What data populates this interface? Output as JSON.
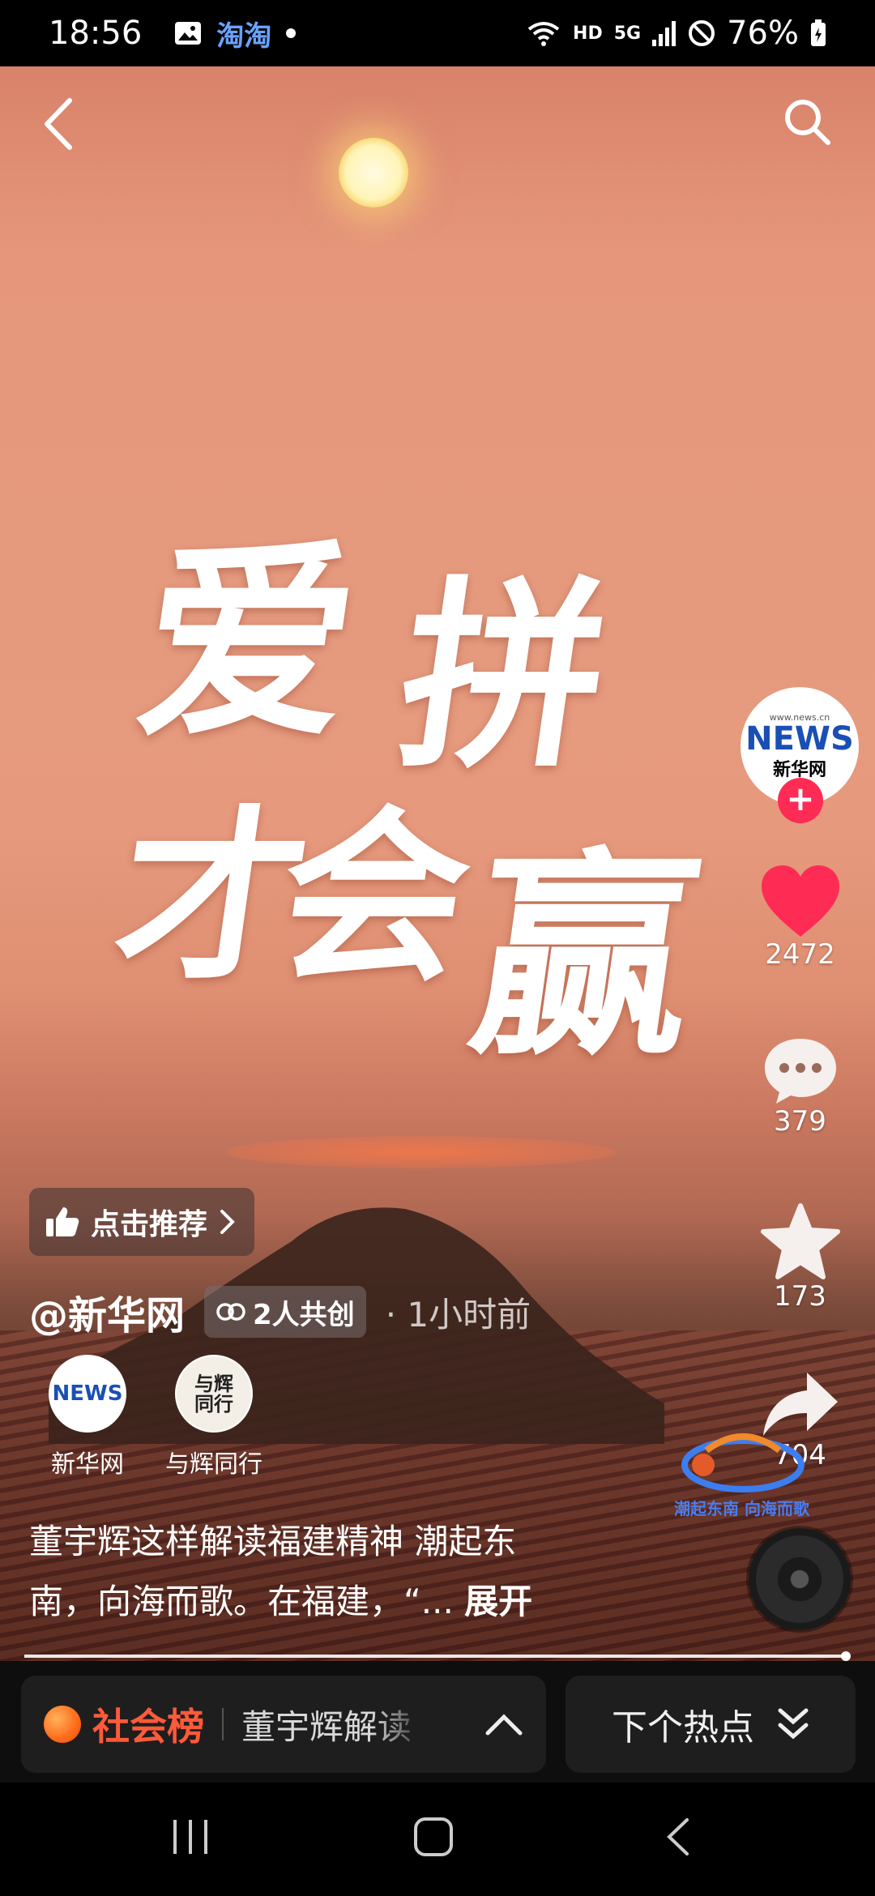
{
  "status_bar": {
    "time": "18:56",
    "app_indicator": "淘淘",
    "network_hd": "HD",
    "network_5g": "5G",
    "battery": "76%"
  },
  "video": {
    "calligraphy": [
      "爱",
      "拼",
      "才",
      "会",
      "赢"
    ]
  },
  "rail": {
    "avatar_logo_text": "NEWS",
    "avatar_logo_cn": "新华网",
    "avatar_logo_url": "www.news.cn",
    "likes": "2472",
    "comments": "379",
    "favorites": "173",
    "shares": "704",
    "topic_badge_text": "潮起东南 向海而歌"
  },
  "recommend": {
    "label": "点击推荐"
  },
  "author": {
    "name": "@新华网",
    "collab": "2人共创",
    "time_ago": "· 1小时前"
  },
  "cocreators": [
    {
      "label": "新华网",
      "logo": "NEWS"
    },
    {
      "label": "与辉同行",
      "logo": "与辉同行"
    }
  ],
  "caption": {
    "line1": "董宇辉这样解读福建精神 潮起东",
    "line2": "南，向海而歌。在福建，“...",
    "expand": "展开"
  },
  "progress": {
    "fraction": 1.0
  },
  "hotbar": {
    "category": "社会榜",
    "headline": "董宇辉解读",
    "next": "下个热点"
  },
  "icons": {
    "back": "chevron-left-icon",
    "search": "search-icon",
    "like": "heart-icon",
    "comment": "comment-icon",
    "favorite": "star-icon",
    "share": "share-icon"
  },
  "colors": {
    "like": "#fe2c55",
    "hot_title": "#ff5a3a",
    "follow": "#fe2c55"
  }
}
